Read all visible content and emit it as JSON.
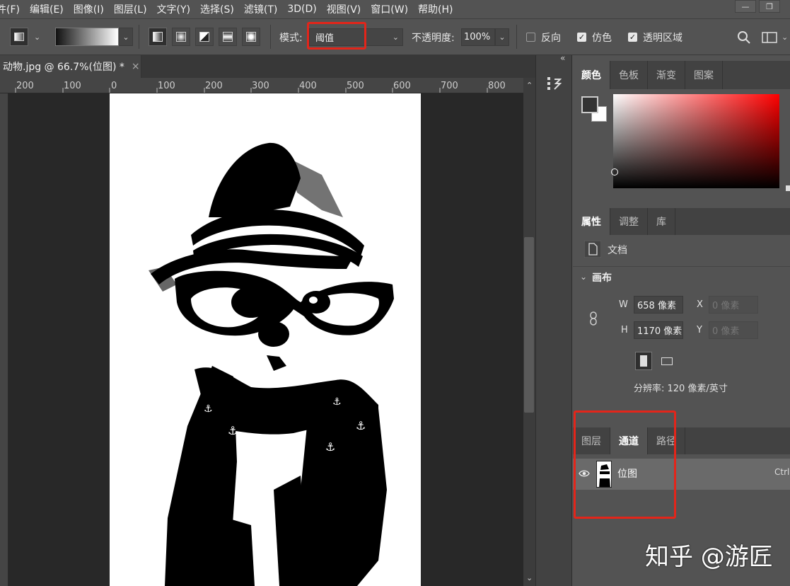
{
  "menu": [
    "件(F)",
    "编辑(E)",
    "图像(I)",
    "图层(L)",
    "文字(Y)",
    "选择(S)",
    "滤镜(T)",
    "3D(D)",
    "视图(V)",
    "窗口(W)",
    "帮助(H)"
  ],
  "window_buttons": {
    "minimize": "—",
    "restore": "❐"
  },
  "options": {
    "mode_label": "模式:",
    "mode_value": "阈值",
    "opacity_label": "不透明度:",
    "opacity_value": "100%",
    "reverse_label": "反向",
    "dither_label": "仿色",
    "transparency_label": "透明区域",
    "reverse_checked": false,
    "dither_checked": true,
    "transparency_checked": true
  },
  "document_tab": {
    "title": "动物.jpg @ 66.7%(位图) *",
    "close": "×"
  },
  "ruler_labels": [
    "200",
    "100",
    "0",
    "100",
    "200",
    "300",
    "400",
    "500",
    "600",
    "700",
    "800"
  ],
  "color_panel": {
    "tabs": [
      "颜色",
      "色板",
      "渐变",
      "图案"
    ],
    "active": 0,
    "base_hue": "#ff0000"
  },
  "properties_panel": {
    "tabs": [
      "属性",
      "调整",
      "库"
    ],
    "active": 0,
    "doc_label": "文档",
    "canvas_section": "画布",
    "w_label": "W",
    "w_value": "658 像素",
    "h_label": "H",
    "h_value": "1170 像素",
    "x_label": "X",
    "x_value": "0 像素",
    "y_label": "Y",
    "y_value": "0 像素",
    "resolution": "分辨率: 120 像素/英寸"
  },
  "channels_panel": {
    "tabs": [
      "图层",
      "通道",
      "路径"
    ],
    "active": 1,
    "channel_name": "位图",
    "shortcut": "Ctrl+"
  },
  "watermark": "知乎 @游匠",
  "colors": {
    "highlight_red": "#e3251a",
    "panel_bg": "#535353",
    "canvas_bg": "#282828"
  }
}
